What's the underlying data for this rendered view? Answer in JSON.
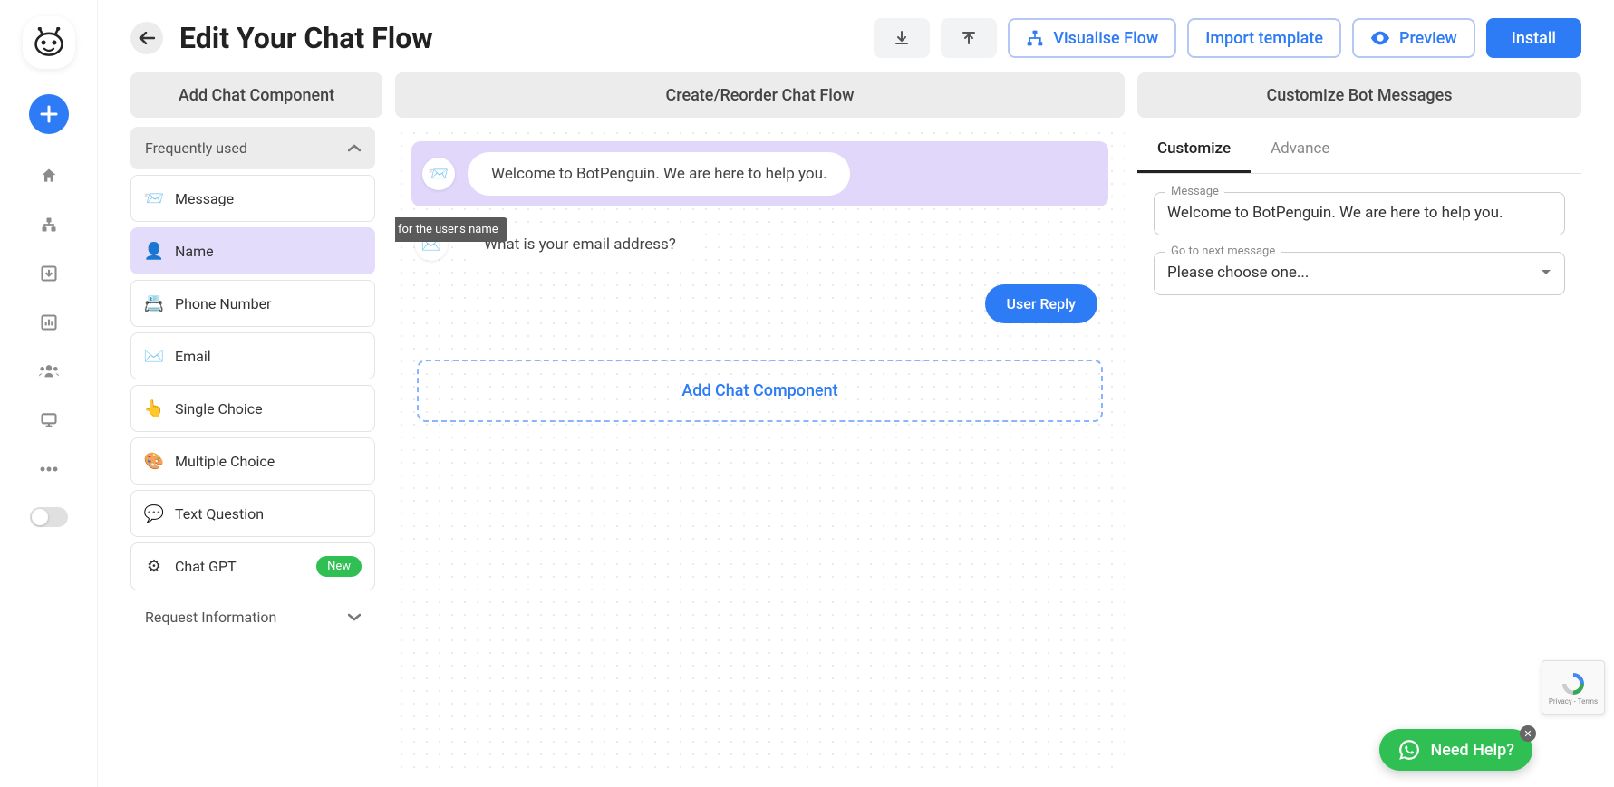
{
  "header": {
    "title": "Edit Your Chat Flow",
    "visualise": "Visualise Flow",
    "import": "Import template",
    "preview": "Preview",
    "install": "Install"
  },
  "panels": {
    "left_title": "Add Chat Component",
    "center_title": "Create/Reorder Chat Flow",
    "right_title": "Customize Bot Messages"
  },
  "sections": {
    "frequently_used": "Frequently used",
    "request_info": "Request Information"
  },
  "components": [
    {
      "label": "Message",
      "icon": "📨",
      "selected": false,
      "badge": null
    },
    {
      "label": "Name",
      "icon": "👤",
      "selected": true,
      "badge": null
    },
    {
      "label": "Phone Number",
      "icon": "📇",
      "selected": false,
      "badge": null
    },
    {
      "label": "Email",
      "icon": "✉️",
      "selected": false,
      "badge": null
    },
    {
      "label": "Single Choice",
      "icon": "👆",
      "selected": false,
      "badge": null
    },
    {
      "label": "Multiple Choice",
      "icon": "🎨",
      "selected": false,
      "badge": null
    },
    {
      "label": "Text Question",
      "icon": "💬",
      "selected": false,
      "badge": null
    },
    {
      "label": "Chat GPT",
      "icon": "⚙",
      "selected": false,
      "badge": "New"
    }
  ],
  "flow": {
    "welcome_text": "Welcome to BotPenguin. We are here to help you.",
    "tooltip": "Ask for the user's name",
    "email_prompt": "What is your email address?",
    "user_reply": "User Reply",
    "add_component": "Add Chat Component"
  },
  "customize": {
    "tab_customize": "Customize",
    "tab_advance": "Advance",
    "message_label": "Message",
    "message_value": "Welcome to BotPenguin. We are here to help you.",
    "next_label": "Go to next message",
    "next_value": "Please choose one..."
  },
  "help": {
    "text": "Need Help?"
  },
  "recaptcha": {
    "line1": "Privacy",
    "line2": "Terms"
  }
}
